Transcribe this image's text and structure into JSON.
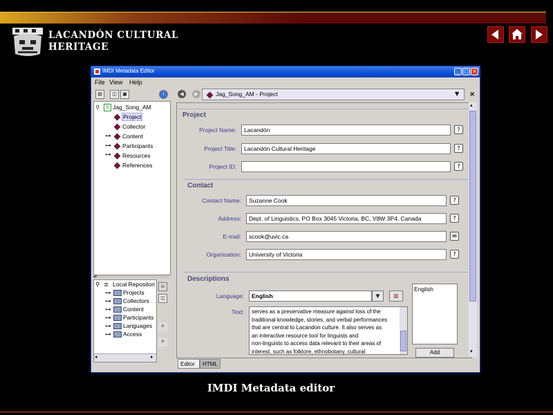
{
  "site": {
    "title": "LACANDÓN CULTURAL HERITAGE",
    "caption": "IMDI Metadata editor"
  },
  "nav": {
    "icons": [
      "arrow-left-icon",
      "home-icon",
      "arrow-right-icon"
    ]
  },
  "window": {
    "title": "IMDI Metadata Editor",
    "menu": [
      "File",
      "View",
      "Help"
    ]
  },
  "tree": {
    "root": "Jag_Song_AM",
    "items": [
      "Project",
      "Collector",
      "Content",
      "Participants",
      "Resources",
      "References"
    ]
  },
  "repo_tree": {
    "root": "Local Repositori",
    "items": [
      "Projects",
      "Collectors",
      "Content",
      "Participants",
      "Languages",
      "Access"
    ]
  },
  "breadcrumb": "Jag_Song_AM - Project",
  "project": {
    "heading": "Project",
    "name_label": "Project Name:",
    "name_value": "Lacandón",
    "title_label": "Project Title:",
    "title_value": "Lacandón Cultural Heritage",
    "id_label": "Project ID:",
    "id_value": ""
  },
  "contact": {
    "heading": "Contact",
    "name_label": "Contact Name:",
    "name_value": "Suzanne Cook",
    "address_label": "Address:",
    "address_value": "Dept. of Linguistics,  PO Box 3045 Victoria, BC, V8W 3P4, Canada",
    "email_label": "E-mail:",
    "email_value": "scook@uvic.ca",
    "org_label": "Organisation:",
    "org_value": "University of Victoria"
  },
  "descriptions": {
    "heading": "Descriptions",
    "language_label": "Language:",
    "language_value": "English",
    "text_label": "Text:",
    "text_lines": [
      "serves as a preservative measure against loss of the",
      "traditional knowledge, stories, and verbal performances",
      "that are central to Lacandon culture.  It also serves as",
      "an interactive  resource tool for linguists and",
      "non-linguists to access data relevant to their areas of",
      "interest, such as folklore, ethnobotany, cultural"
    ],
    "list_item": "English",
    "add_label": "Add"
  },
  "tabs": [
    "Editor",
    "HTML"
  ]
}
